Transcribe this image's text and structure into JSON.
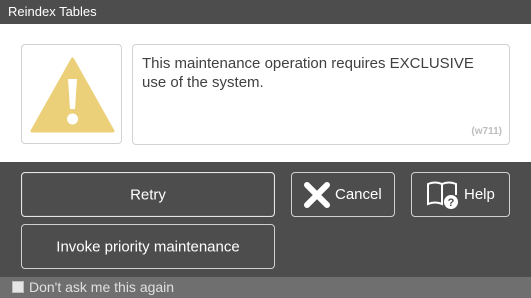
{
  "dialog": {
    "title": "Reindex Tables",
    "message": "This maintenance operation requires EXCLUSIVE use of the system.",
    "code": "(w711)",
    "icon": "warning-icon"
  },
  "buttons": {
    "retry": "Retry",
    "invoke": "Invoke priority maintenance",
    "cancel": "Cancel",
    "help": "Help"
  },
  "footer": {
    "dont_ask": "Don't ask me this again",
    "dont_ask_checked": false
  },
  "colors": {
    "background": "#4d4d4d",
    "warning": "#ecd079"
  }
}
